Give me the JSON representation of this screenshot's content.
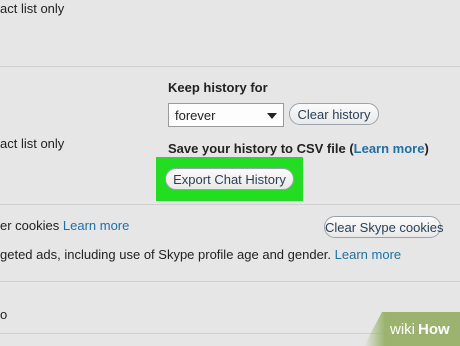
{
  "rows": {
    "top_partial": "act list only",
    "history_partial": "act list only",
    "cookies_partial": "er cookies",
    "cookies_learn_more": "Learn more",
    "ads_partial": "geted ads, including use of Skype profile age and gender.",
    "ads_learn_more": "Learn more",
    "bottom_partial": "o"
  },
  "history": {
    "keep_label": "Keep history for",
    "select_value": "forever",
    "clear_button": "Clear history",
    "save_label": "Save your history to CSV file (",
    "save_learn_more": "Learn more",
    "save_label_end": ")",
    "export_button": "Export Chat History"
  },
  "cookies": {
    "clear_button": "Clear Skype cookies"
  },
  "watermark": {
    "part1": "wiki",
    "part2": "How"
  },
  "colors": {
    "highlight": "#22dd22",
    "link": "#1f6fa8",
    "background": "#e6e6e6"
  }
}
